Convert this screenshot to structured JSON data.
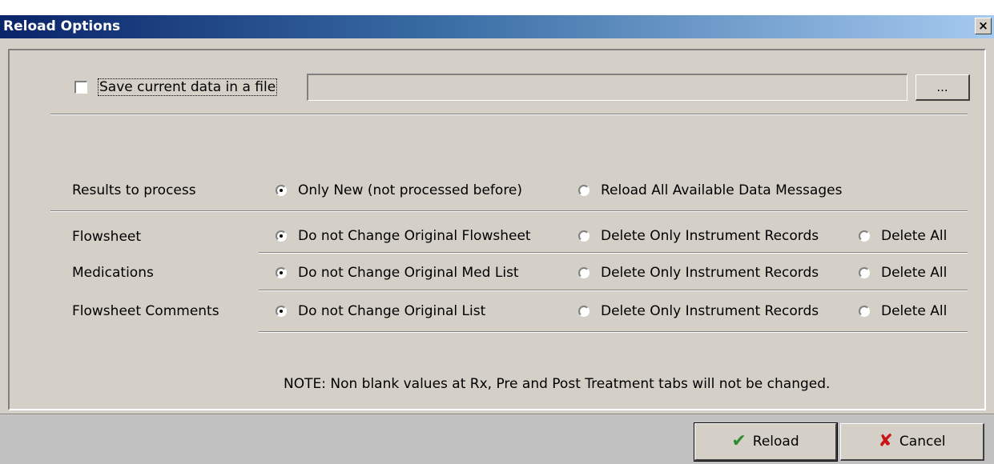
{
  "window": {
    "title": "Reload Options",
    "close_glyph": "×"
  },
  "save": {
    "checkbox_checked": false,
    "label": "Save current data in a file",
    "path_value": "",
    "browse_label": "..."
  },
  "results": {
    "label": "Results to process",
    "options": [
      "Only New (not processed before)",
      "Reload All Available Data Messages"
    ],
    "selected": 0
  },
  "rows": [
    {
      "label": "Flowsheet",
      "options": [
        "Do not Change Original Flowsheet",
        "Delete Only Instrument Records",
        "Delete All"
      ],
      "selected": 0
    },
    {
      "label": "Medications",
      "options": [
        "Do not Change Original Med List",
        "Delete Only Instrument Records",
        "Delete All"
      ],
      "selected": 0
    },
    {
      "label": "Flowsheet Comments",
      "options": [
        "Do not Change Original List",
        "Delete Only Instrument Records",
        "Delete All"
      ],
      "selected": 0
    }
  ],
  "note": "NOTE: Non blank values at Rx, Pre and Post Treatment tabs will not be changed.",
  "buttons": {
    "reload": "Reload",
    "cancel": "Cancel",
    "reload_icon": "checkmark-icon",
    "cancel_icon": "x-icon"
  },
  "colors": {
    "titlebar_start": "#0a246a",
    "titlebar_end": "#a6caf0",
    "face": "#d4d0c8",
    "check_green": "#2e8b2e",
    "cancel_red": "#c81414"
  }
}
